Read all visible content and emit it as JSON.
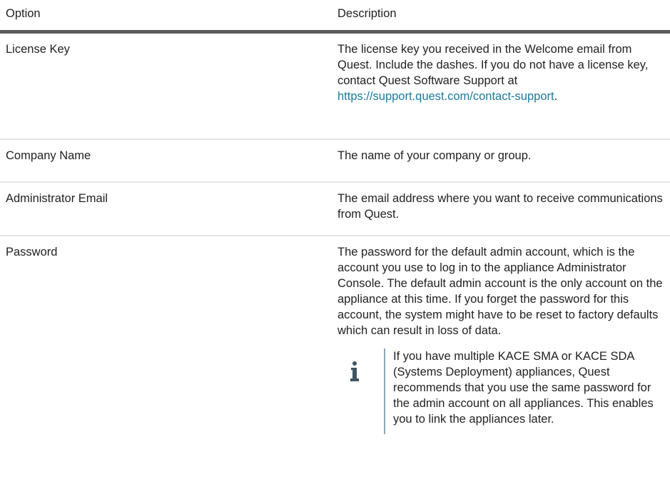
{
  "header": {
    "option": "Option",
    "description": "Description"
  },
  "rows": [
    {
      "option": "License Key",
      "description_before_link": "The license key you received in the Welcome email from Quest. Include the dashes. If you do not have a license key, contact Quest Software Support at ",
      "link": "https://support.quest.com/contact-support",
      "description_after_link": "."
    },
    {
      "option": "Company Name",
      "description": "The name of your company or group."
    },
    {
      "option": "Administrator Email",
      "description": "The email address where you want to receive communications from Quest."
    },
    {
      "option": "Password",
      "description": "The password for the default admin account, which is the account you use to log in to the appliance Administrator Console. The default admin account is the only account on the appliance at this time. If you forget the password for this account, the system might have to be reset to factory defaults which can result in loss of data.",
      "note": {
        "icon": "info-icon",
        "text": "If you have multiple KACE SMA or KACE SDA (Systems Deployment) appliances, Quest recommends that you use the same password for the admin account on all appliances. This enables you to link the appliances later."
      }
    }
  ],
  "colors": {
    "text": "#222222",
    "link": "#1a7aa0",
    "header_rule": "#5b5b5b",
    "row_rule": "#e6e6e6",
    "note_bar": "#8ea7b6",
    "icon": "#3f5563"
  }
}
